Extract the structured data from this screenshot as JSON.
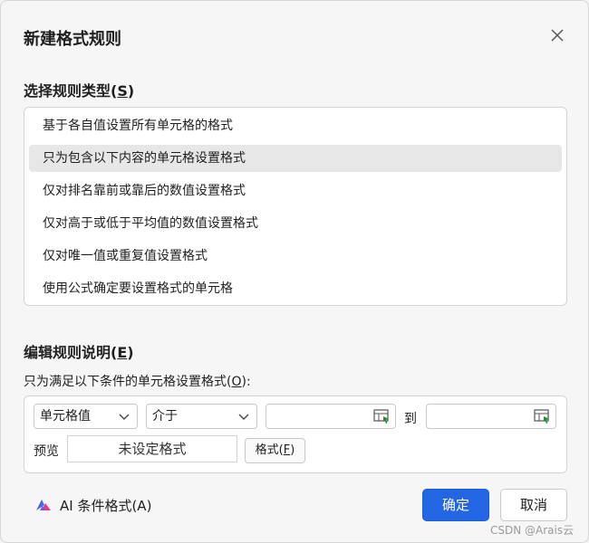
{
  "dialog": {
    "title": "新建格式规则"
  },
  "rule_type": {
    "title": "选择规则类型",
    "title_suffix_open": "(",
    "hotkey": "S",
    "title_suffix_close": ")",
    "items": [
      "基于各自值设置所有单元格的格式",
      "只为包含以下内容的单元格设置格式",
      "仅对排名靠前或靠后的数值设置格式",
      "仅对高于或低于平均值的数值设置格式",
      "仅对唯一值或重复值设置格式",
      "使用公式确定要设置格式的单元格"
    ],
    "selected_index": 1
  },
  "rule_desc": {
    "title": "编辑规则说明",
    "title_suffix_open": "(",
    "hotkey": "E",
    "title_suffix_close": ")",
    "condition_label_pre": "只为满足以下条件的单元格设置格式(",
    "condition_hotkey": "O",
    "condition_label_post": "):",
    "field_select": "单元格值",
    "operator_select": "介于",
    "to_label": "到",
    "preview_label": "预览",
    "preview_text": "未设定格式",
    "format_button_pre": "格式(",
    "format_hotkey": "F",
    "format_button_post": ")"
  },
  "footer": {
    "ai_label": "AI 条件格式(A)",
    "ok_label": "确定",
    "cancel_label": "取消"
  },
  "watermark": "CSDN @Arais云",
  "colors": {
    "primary": "#2266e3",
    "selected_row": "#e7e7e7"
  }
}
